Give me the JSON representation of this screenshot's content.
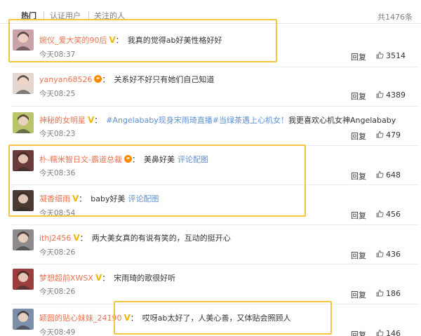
{
  "tabs": [
    {
      "label": "热门"
    },
    {
      "label": "认证用户"
    },
    {
      "label": "关注的人"
    }
  ],
  "total_label": "共1476条",
  "comments": [
    {
      "user": "婉仪_爱大笑的90后",
      "badge": "V",
      "text": "我真的觉得ab好美性格好好",
      "topic": "",
      "link": "",
      "time": "今天08:37",
      "reply": "回复",
      "likes": "3514",
      "avatar_color": "#c9a3a8"
    },
    {
      "user": "yanyan68526",
      "badge": "orange",
      "text": "关系好不好只有她们自己知道",
      "topic": "",
      "link": "",
      "time": "今天08:25",
      "reply": "回复",
      "likes": "4389",
      "avatar_color": "#e3d7d0"
    },
    {
      "user": "神秘的女明星",
      "badge": "V",
      "text": "我更喜欢心机女神Angelababy",
      "topic": "#Angelababy现身宋雨琦直播#当绿茶遇上心机女！",
      "link": "",
      "time": "今天08:23",
      "reply": "回复",
      "likes": "479",
      "avatar_color": "#b9c46c"
    },
    {
      "user": "朴-糯米智日文-霸道总裁",
      "badge": "orange",
      "text": "美鼻好美",
      "topic": "",
      "link": "评论配图",
      "time": "今天08:36",
      "reply": "回复",
      "likes": "648",
      "avatar_color": "#6b3a3a"
    },
    {
      "user": "凝香细雨",
      "badge": "V",
      "text": "baby好美",
      "topic": "",
      "link": "评论配图",
      "time": "今天08:54",
      "reply": "回复",
      "likes": "456",
      "avatar_color": "#4a3a32"
    },
    {
      "user": "ithj2456",
      "badge": "V",
      "text": "两大美女真的有说有笑的，互动的挺开心",
      "topic": "",
      "link": "",
      "time": "今天08:26",
      "reply": "回复",
      "likes": "436",
      "avatar_color": "#8d8a8c"
    },
    {
      "user": "梦想超前XWSX",
      "badge": "V",
      "text": "宋雨琦的歌很好听",
      "topic": "",
      "link": "",
      "time": "今天08:26",
      "reply": "回复",
      "likes": "186",
      "avatar_color": "#9b3e3e"
    },
    {
      "user": "颖圆的贴心妹妹_24190",
      "badge": "V",
      "text": "哎呀ab太好了，人美心善，又体贴会照顾人",
      "topic": "",
      "link": "",
      "time": "今天08:49",
      "reply": "回复",
      "likes": "146",
      "avatar_color": "#7b8fa8"
    }
  ],
  "colors": {
    "username": "#eb7350",
    "link": "#5e8fd4",
    "highlight": "#f5c542",
    "vip_badge": "#f2b705"
  }
}
